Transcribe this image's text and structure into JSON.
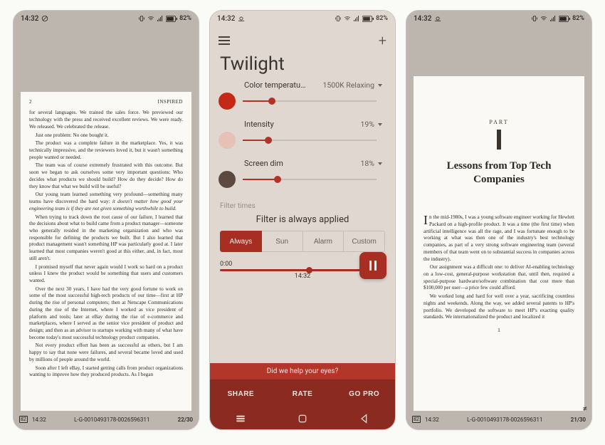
{
  "status": {
    "time": "14:32",
    "battery_pct": "82%",
    "battery_label": "82"
  },
  "reader1": {
    "page_num": "2",
    "running_head": "INSPIRED",
    "paragraphs": [
      "for several languages. We trained the sales force. We previewed our technology with the press and received excellent reviews. We were ready. We released. We celebrated the release.",
      "Just one problem: No one bought it.",
      "The product was a complete failure in the marketplace. Yes, it was technically impressive, and the reviewers loved it, but it wasn't something people wanted or needed.",
      "The team was of course extremely frustrated with this outcome. But soon we began to ask ourselves some very important questions: Who decides what products we should build? How do they decide? How do they know that what we build will be useful?",
      "Our young team learned something very profound—something many teams have discovered the hard way: it doesn't matter how good your engineering team is if they are not given something worthwhile to build.",
      "When trying to track down the root cause of our failure, I learned that the decisions about what to build came from a product manager—someone who generally resided in the marketing organization and who was responsible for defining the products we built. But I also learned that product management wasn't something HP was particularly good at. I later learned that most companies weren't good at this either, and, in fact, most still aren't.",
      "I promised myself that never again would I work so hard on a product unless I knew the product would be something that users and customers wanted.",
      "Over the next 30 years, I have had the very good fortune to work on some of the most successful high-tech products of our time—first at HP during the rise of personal computers; then at Netscape Communications during the rise of the Internet, where I worked as vice president of platform and tools; later at eBay during the rise of e-commerce and marketplaces, where I served as the senior vice president of product and design; and then as an advisor to startups working with many of what have become today's most successful technology product companies.",
      "Not every product effort has been as successful as others, but I am happy to say that none were failures, and several became loved and used by millions of people around the world.",
      "Soon after I left eBay, I started getting calls from product organizations wanting to improve how they produced products. As I began"
    ],
    "italic_para_index": 4,
    "footer": {
      "serial": "L-G-0010493178-0026596311",
      "page": "22/30"
    }
  },
  "twilight": {
    "app_title": "Twilight",
    "controls": {
      "color_temp": {
        "label": "Color temperatu…",
        "value": "1500K Relaxing",
        "pct": 22
      },
      "intensity": {
        "label": "Intensity",
        "value": "19%",
        "pct": 19
      },
      "screen_dim": {
        "label": "Screen dim",
        "value": "18%",
        "pct": 26
      }
    },
    "filter_times_label": "Filter times",
    "filter_applied_label": "Filter is always applied",
    "segments": [
      "Always",
      "Sun",
      "Alarm",
      "Custom"
    ],
    "active_segment": 0,
    "player": {
      "start": "0:00",
      "now": "14:32",
      "pos_pct": 54
    },
    "help_banner": "Did we help your eyes?",
    "actions": [
      "SHARE",
      "RATE",
      "GO PRO"
    ]
  },
  "reader3": {
    "part_label": "PART",
    "part_title": "Lessons from Top Tech Companies",
    "paragraphs": [
      "In the mid-1980s, I was a young software engineer working for Hewlett Packard on a high-profile product. It was a time (the first time) when artificial intelligence was all the rage, and I was fortunate enough to be working at what was then one of the industry's best technology companies, as part of a very strong software engineering team (several members of that team went on to substantial success in companies across the industry).",
      "Our assignment was a difficult one: to deliver AI-enabling technology on a low-cost, general-purpose workstation that, until then, required a special-purpose hardware/software combination that cost more than $100,000 per user—a price few could afford.",
      "We worked long and hard for well over a year, sacrificing countless nights and weekends. Along the way, we added several patents to HP's portfolio. We developed the software to meet HP's exacting quality standards. We internationalized the product and localized it"
    ],
    "page_in_book": "1",
    "footer": {
      "serial": "L-G-0010493178-0026596311",
      "page": "21/30"
    },
    "corner_mark": "≠"
  }
}
